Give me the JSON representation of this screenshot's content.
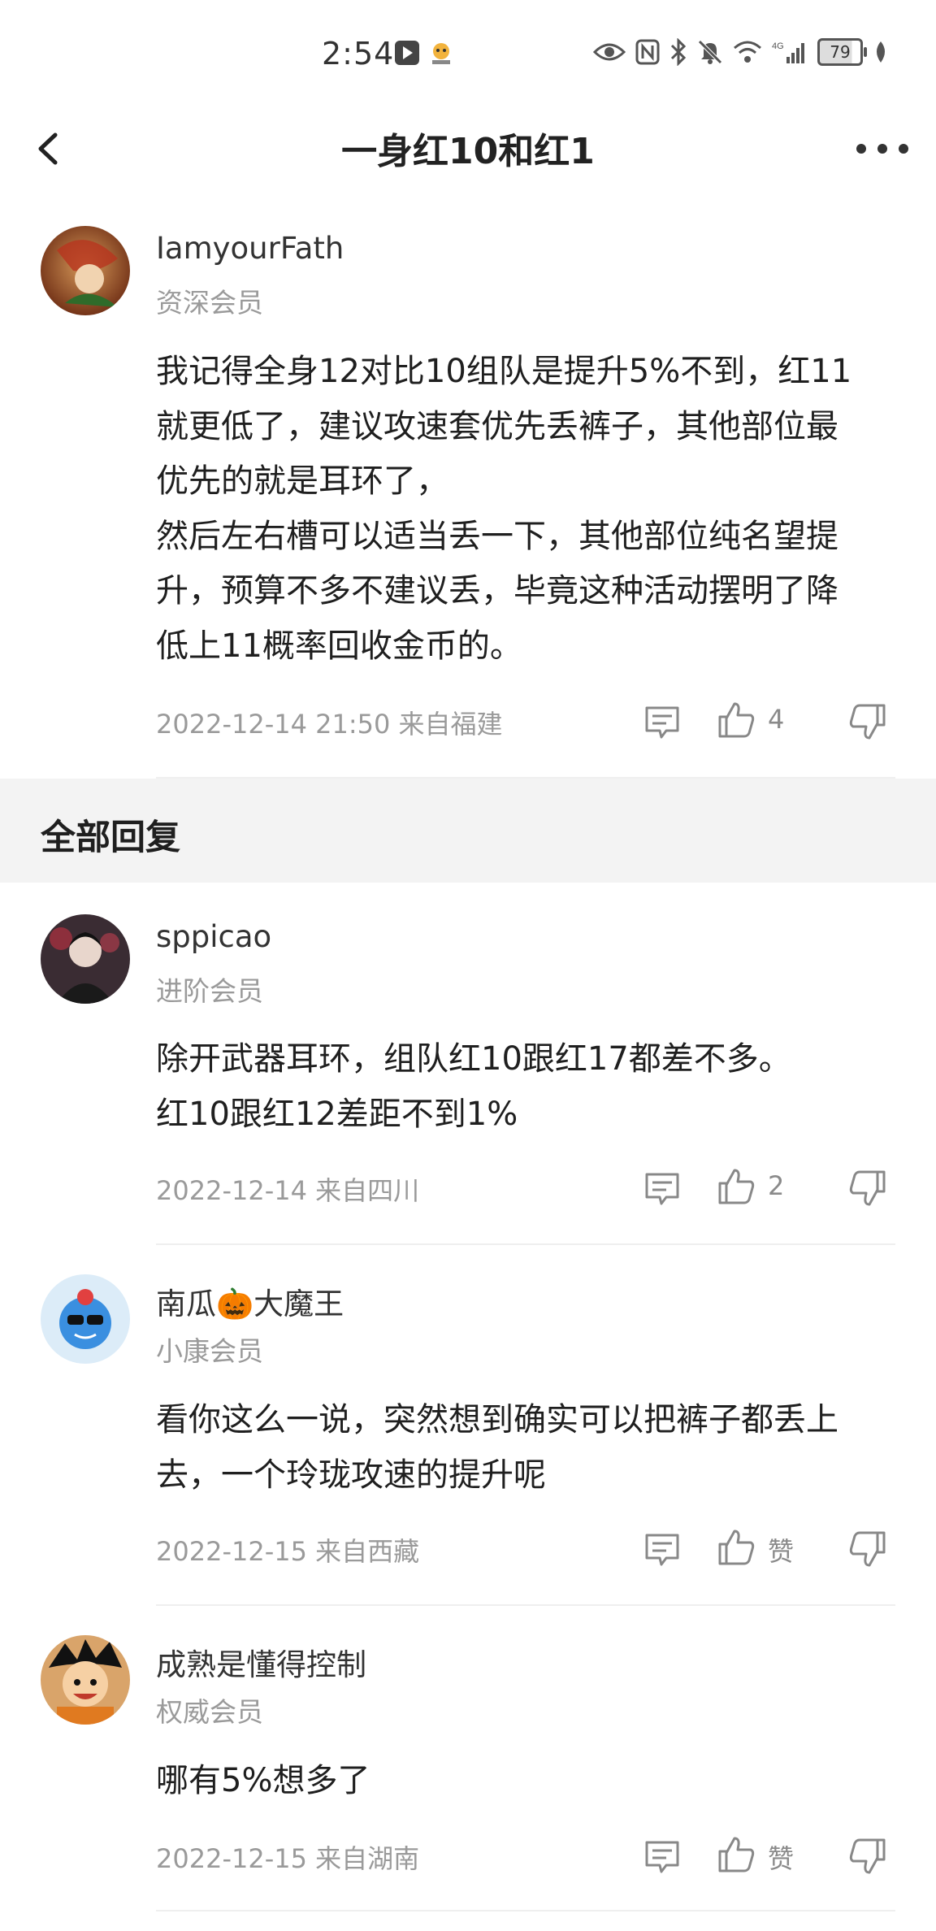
{
  "status_bar": {
    "time": "2:54",
    "battery": "79",
    "network": "4G"
  },
  "header": {
    "title": "一身红10和红1"
  },
  "main_post": {
    "author": "IamyourFath",
    "level": "资深会员",
    "content": "我记得全身12对比10组队是提升5%不到，红11\n就更低了，建议攻速套优先丢裤子，其他部位最\n优先的就是耳环了，\n然后左右槽可以适当丢一下，其他部位纯名望提\n升，预算不多不建议丢，毕竟这种活动摆明了降\n低上11概率回收金币的。",
    "timestamp": "2022-12-14 21:50  来自福建",
    "likes": "4"
  },
  "section": {
    "title": "全部回复"
  },
  "replies": [
    {
      "author": "sppicao",
      "level": "进阶会员",
      "content": "除开武器耳环，组队红10跟红17都差不多。\n红10跟红12差距不到1%",
      "timestamp": "2022-12-14 来自四川",
      "likes": "2"
    },
    {
      "author": "南瓜🎃大魔王",
      "level": "小康会员",
      "content": "看你这么一说，突然想到确实可以把裤子都丢上\n去，一个玲珑攻速的提升呢",
      "timestamp": "2022-12-15 来自西藏",
      "likes": "赞"
    },
    {
      "author": "成熟是懂得控制",
      "level": "权威会员",
      "content": "哪有5%想多了",
      "timestamp": "2022-12-15 来自湖南",
      "likes": "赞"
    }
  ],
  "colors": {
    "text_primary": "#1f1f1f",
    "text_secondary": "#9a9a9a",
    "section_bg": "#f3f3f3"
  },
  "icons": [
    "back-arrow-icon",
    "more-dots-icon",
    "reply-icon",
    "thumbs-up-icon",
    "thumbs-down-icon",
    "eye-icon",
    "nfc-icon",
    "bluetooth-icon",
    "mute-icon",
    "wifi-icon",
    "signal-icon",
    "battery-icon"
  ]
}
